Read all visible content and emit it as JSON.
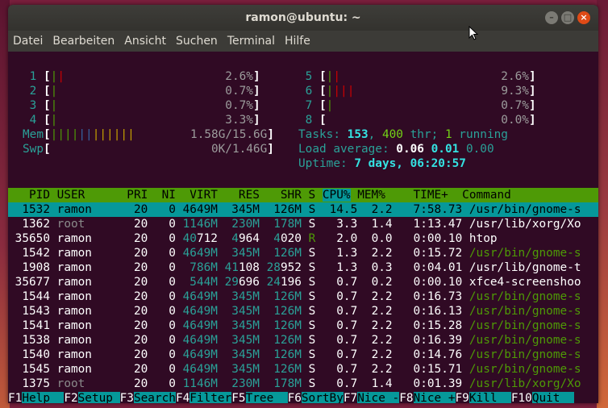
{
  "window": {
    "title": "ramon@ubuntu: ~"
  },
  "menu": [
    "Datei",
    "Bearbeiten",
    "Ansicht",
    "Suchen",
    "Terminal",
    "Hilfe"
  ],
  "cpus": [
    {
      "n": "1",
      "bars": "||",
      "pct": "2.6%"
    },
    {
      "n": "2",
      "bars": "|",
      "pct": "0.7%"
    },
    {
      "n": "3",
      "bars": "|",
      "pct": "0.7%"
    },
    {
      "n": "4",
      "bars": "|",
      "pct": "3.3%"
    },
    {
      "n": "5",
      "bars": "||",
      "pct": "2.6%"
    },
    {
      "n": "6",
      "bars": "||||",
      "pct": "9.3%"
    },
    {
      "n": "7",
      "bars": "|",
      "pct": "0.7%"
    },
    {
      "n": "8",
      "bars": "",
      "pct": "0.0%"
    }
  ],
  "mem": {
    "label": "Mem",
    "bars": "||||||||||||",
    "value": "1.58G/15.6G"
  },
  "swp": {
    "label": "Swp",
    "bars": "",
    "value": "0K/1.46G"
  },
  "tasks": {
    "label": "Tasks:",
    "count": "153",
    "sep1": ",",
    "thr": "400",
    "thr_label": "thr;",
    "running": "1",
    "running_label": "running"
  },
  "load": {
    "label": "Load average:",
    "v1": "0.06",
    "v2": "0.01",
    "v3": "0.00"
  },
  "uptime": {
    "label": "Uptime:",
    "value": "7 days, 06:20:57"
  },
  "header": {
    "pid": "PID",
    "user": "USER",
    "pri": "PRI",
    "ni": "NI",
    "virt": "VIRT",
    "res": "RES",
    "shr": "SHR",
    "s": "S",
    "cpu": "CPU%",
    "mem": "MEM%",
    "time": "TIME+",
    "cmd": "Command"
  },
  "processes": [
    {
      "pid": "1532",
      "user": "ramon",
      "pri": "20",
      "ni": "0",
      "virt": "4649M",
      "res": "345M",
      "shr": "126M",
      "s": "S",
      "cpu": "14.5",
      "mem": "2.2",
      "time": "7:58.73",
      "cmd": "/usr/bin/gnome-s"
    },
    {
      "pid": "1362",
      "user": "root",
      "pri": "20",
      "ni": "0",
      "virt": "1146M",
      "res": "230M",
      "shr": "178M",
      "s": "S",
      "cpu": "3.3",
      "mem": "1.4",
      "time": "1:13.47",
      "cmd": "/usr/lib/xorg/Xo"
    },
    {
      "pid": "35650",
      "user": "ramon",
      "pri": "20",
      "ni": "0",
      "virt": "40712",
      "res": "4964",
      "shr": "4020",
      "s": "R",
      "cpu": "2.0",
      "mem": "0.0",
      "time": "0:00.10",
      "cmd": "htop"
    },
    {
      "pid": "1542",
      "user": "ramon",
      "pri": "20",
      "ni": "0",
      "virt": "4649M",
      "res": "345M",
      "shr": "126M",
      "s": "S",
      "cpu": "1.3",
      "mem": "2.2",
      "time": "0:15.72",
      "cmd": "/usr/bin/gnome-s"
    },
    {
      "pid": "1908",
      "user": "ramon",
      "pri": "20",
      "ni": "0",
      "virt": "786M",
      "res": "41108",
      "shr": "28952",
      "s": "S",
      "cpu": "1.3",
      "mem": "0.3",
      "time": "0:04.01",
      "cmd": "/usr/lib/gnome-t"
    },
    {
      "pid": "35677",
      "user": "ramon",
      "pri": "20",
      "ni": "0",
      "virt": "544M",
      "res": "29696",
      "shr": "24196",
      "s": "S",
      "cpu": "0.7",
      "mem": "0.2",
      "time": "0:00.10",
      "cmd": "xfce4-screenshoo"
    },
    {
      "pid": "1544",
      "user": "ramon",
      "pri": "20",
      "ni": "0",
      "virt": "4649M",
      "res": "345M",
      "shr": "126M",
      "s": "S",
      "cpu": "0.7",
      "mem": "2.2",
      "time": "0:16.73",
      "cmd": "/usr/bin/gnome-s"
    },
    {
      "pid": "1543",
      "user": "ramon",
      "pri": "20",
      "ni": "0",
      "virt": "4649M",
      "res": "345M",
      "shr": "126M",
      "s": "S",
      "cpu": "0.7",
      "mem": "2.2",
      "time": "0:16.13",
      "cmd": "/usr/bin/gnome-s"
    },
    {
      "pid": "1541",
      "user": "ramon",
      "pri": "20",
      "ni": "0",
      "virt": "4649M",
      "res": "345M",
      "shr": "126M",
      "s": "S",
      "cpu": "0.7",
      "mem": "2.2",
      "time": "0:15.28",
      "cmd": "/usr/bin/gnome-s"
    },
    {
      "pid": "1538",
      "user": "ramon",
      "pri": "20",
      "ni": "0",
      "virt": "4649M",
      "res": "345M",
      "shr": "126M",
      "s": "S",
      "cpu": "0.7",
      "mem": "2.2",
      "time": "0:16.39",
      "cmd": "/usr/bin/gnome-s"
    },
    {
      "pid": "1540",
      "user": "ramon",
      "pri": "20",
      "ni": "0",
      "virt": "4649M",
      "res": "345M",
      "shr": "126M",
      "s": "S",
      "cpu": "0.7",
      "mem": "2.2",
      "time": "0:14.76",
      "cmd": "/usr/bin/gnome-s"
    },
    {
      "pid": "1545",
      "user": "ramon",
      "pri": "20",
      "ni": "0",
      "virt": "4649M",
      "res": "345M",
      "shr": "126M",
      "s": "S",
      "cpu": "0.7",
      "mem": "2.2",
      "time": "0:15.71",
      "cmd": "/usr/bin/gnome-s"
    },
    {
      "pid": "1375",
      "user": "root",
      "pri": "20",
      "ni": "0",
      "virt": "1146M",
      "res": "230M",
      "shr": "178M",
      "s": "S",
      "cpu": "0.7",
      "mem": "1.4",
      "time": "0:01.39",
      "cmd": "/usr/lib/xorg/Xo"
    }
  ],
  "fkeys": [
    {
      "key": "F1",
      "label": "Help  "
    },
    {
      "key": "F2",
      "label": "Setup "
    },
    {
      "key": "F3",
      "label": "Search"
    },
    {
      "key": "F4",
      "label": "Filter"
    },
    {
      "key": "F5",
      "label": "Tree  "
    },
    {
      "key": "F6",
      "label": "SortBy"
    },
    {
      "key": "F7",
      "label": "Nice -"
    },
    {
      "key": "F8",
      "label": "Nice +"
    },
    {
      "key": "F9",
      "label": "Kill  "
    },
    {
      "key": "F10",
      "label": "Quit  "
    }
  ]
}
